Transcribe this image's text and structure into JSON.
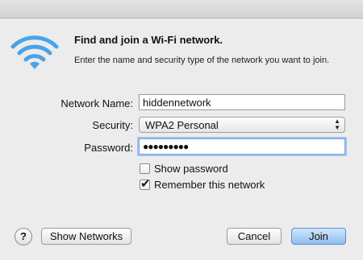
{
  "dialog": {
    "title": "Find and join a Wi-Fi network.",
    "subtitle": "Enter the name and security type of the network you want to join."
  },
  "form": {
    "network_name_label": "Network Name:",
    "network_name_value": "hiddennetwork",
    "security_label": "Security:",
    "security_value": "WPA2 Personal",
    "password_label": "Password:",
    "password_value": "●●●●●●●●●"
  },
  "options": {
    "show_password_label": "Show password",
    "show_password_checked": false,
    "remember_label": "Remember this network",
    "remember_checked": true
  },
  "buttons": {
    "help": "?",
    "show_networks": "Show Networks",
    "cancel": "Cancel",
    "join": "Join"
  },
  "colors": {
    "wifi_icon": "#4aa3e8",
    "focus_ring": "#9ec3f2",
    "default_button": "#8fbdf0"
  },
  "icons": {
    "wifi": "wifi-icon",
    "check": "checkmark-icon",
    "popup_arrows": "updown-arrows-icon"
  }
}
